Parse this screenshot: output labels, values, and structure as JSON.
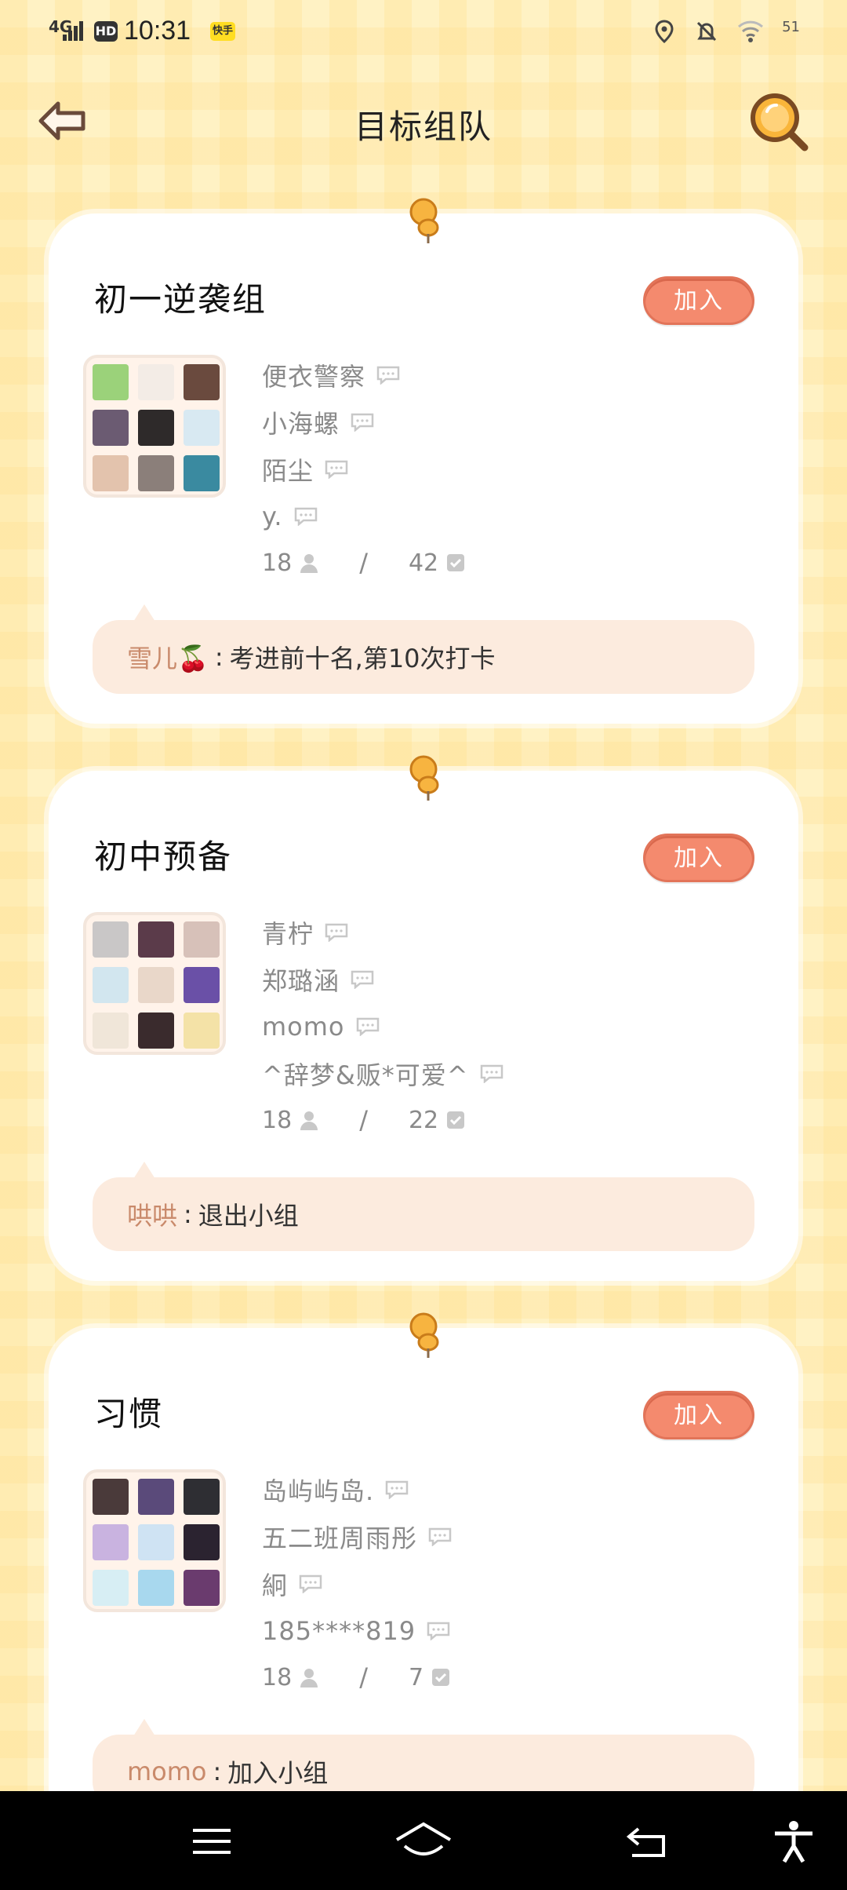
{
  "status_bar": {
    "network": "4G",
    "hd": "HD",
    "time": "10:31",
    "app_badge": "快手",
    "battery": "51"
  },
  "header": {
    "title": "目标组队"
  },
  "groups": [
    {
      "title": "初一逆袭组",
      "join_label": "加入",
      "avatar_colors": [
        "#9bd27a",
        "#f3ece6",
        "#6a4a3e",
        "#6b5b72",
        "#2e2a2a",
        "#d8e9f2",
        "#e3c3ad",
        "#8b7f7a",
        "#3a8aa0"
      ],
      "members": [
        "便衣警察",
        "小海螺",
        "陌尘",
        "y."
      ],
      "member_count": "18",
      "task_count": "42",
      "activity_user": "雪儿🍒",
      "activity_text": "考进前十名,第10次打卡"
    },
    {
      "title": "初中预备",
      "join_label": "加入",
      "avatar_colors": [
        "#c9c7c7",
        "#5b3b4a",
        "#d7c1b9",
        "#d2e6ef",
        "#e9d7c9",
        "#6a50a7",
        "#f0e6d9",
        "#3a2b2d",
        "#f4e2a7"
      ],
      "members": [
        "青柠",
        "郑璐涵",
        "momo",
        "^辞梦&贩*可爱^"
      ],
      "member_count": "18",
      "task_count": "22",
      "activity_user": "哄哄",
      "activity_text": "退出小组"
    },
    {
      "title": "习惯",
      "join_label": "加入",
      "avatar_colors": [
        "#4a3a3a",
        "#5a4a7a",
        "#2e2e33",
        "#c9b3e0",
        "#cfe3f3",
        "#2b2330",
        "#d7eef4",
        "#a8d8ee",
        "#6a3b6e"
      ],
      "members": [
        "岛屿屿岛.",
        "五二班周雨彤",
        "絅",
        "185****819"
      ],
      "member_count": "18",
      "task_count": "7",
      "activity_user": "momo",
      "activity_text": "加入小组"
    }
  ],
  "activity_colon": ":",
  "stats_separator": "/"
}
